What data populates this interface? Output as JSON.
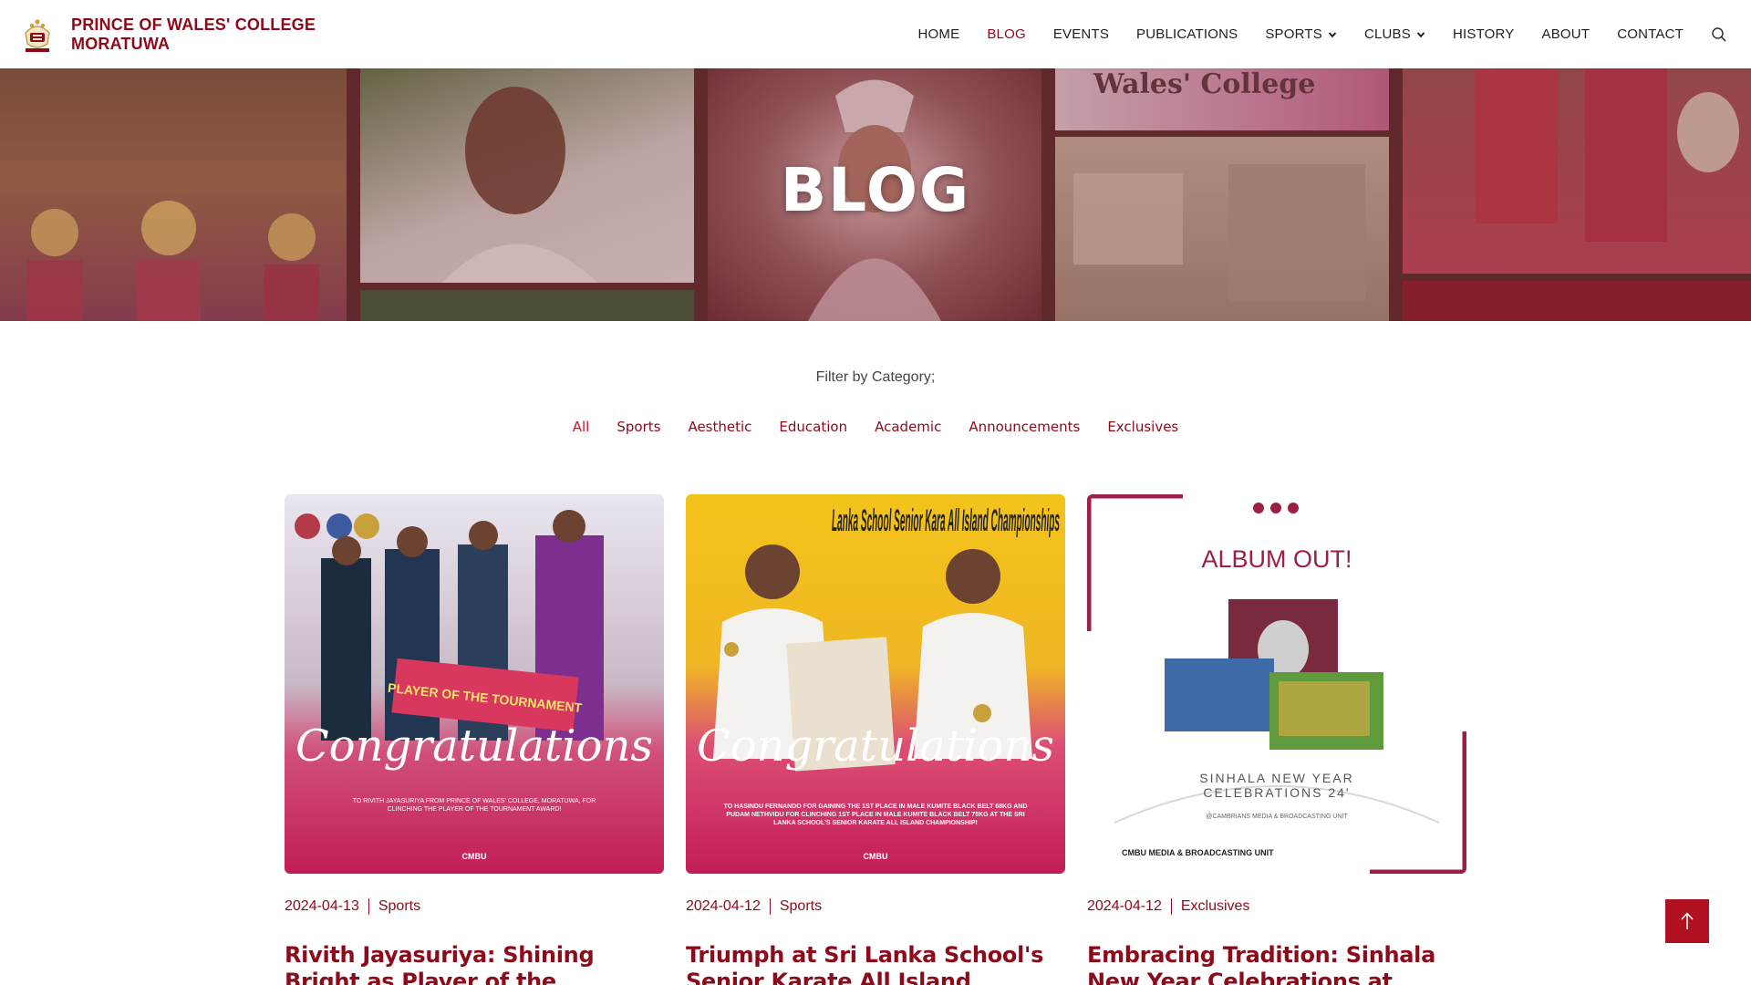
{
  "header": {
    "brand_line1": "PRINCE OF WALES' COLLEGE",
    "brand_line2": "MORATUWA",
    "crest_icon": "college-crest-logo",
    "nav": [
      {
        "label": "HOME",
        "active": false
      },
      {
        "label": "BLOG",
        "active": true
      },
      {
        "label": "EVENTS",
        "active": false
      },
      {
        "label": "PUBLICATIONS",
        "active": false
      },
      {
        "label": "SPORTS",
        "active": false,
        "dropdown": true
      },
      {
        "label": "CLUBS",
        "active": false,
        "dropdown": true
      },
      {
        "label": "HISTORY",
        "active": false
      },
      {
        "label": "ABOUT",
        "active": false
      },
      {
        "label": "CONTACT",
        "active": false
      }
    ],
    "search_icon": "search-icon"
  },
  "hero": {
    "title": "BLOG",
    "tile_texts": [
      "Wales' College"
    ]
  },
  "filter": {
    "label": "Filter by Category;",
    "categories": [
      "All",
      "Sports",
      "Aesthetic",
      "Education",
      "Academic",
      "Announcements",
      "Exclusives"
    ],
    "active": "All"
  },
  "cards": [
    {
      "date": "2024-04-13",
      "category": "Sports",
      "title": "Rivith Jayasuriya: Shining Bright as Player of the Tournament",
      "image_text": "Congratulations",
      "image_banner": "PLAYER OF THE TOURNAMENT",
      "image_caption": "TO RIVITH JAYASURIYA FROM PRINCE OF WALES' COLLEGE, MORATUWA, FOR CLINCHING THE PLAYER OF THE TOURNAMENT AWARD!",
      "image_footer": "CMBU"
    },
    {
      "date": "2024-04-12",
      "category": "Sports",
      "title": "Triumph at Sri Lanka School's Senior Karate All Island Championship",
      "image_text": "Congratulations",
      "image_banner": "Lanka School Senior Kara All Island Championships",
      "image_caption": "TO HASINDU FERNANDO FOR GAINING THE 1ST PLACE IN MALE KUMITE BLACK BELT 68KG AND PUDAM NETHVIDU FOR CLINCHING 1ST PLACE IN MALE KUMITE BLACK BELT 75KG AT THE SRI LANKA SCHOOL'S SENIOR KARATE ALL ISLAND CHAMPIONSHIP!",
      "image_footer": "CMBU"
    },
    {
      "date": "2024-04-12",
      "category": "Exclusives",
      "title": "Embracing Tradition: Sinhala New Year Celebrations at Prince of Wales",
      "image_text": "ALBUM OUT!",
      "image_banner": "SINHALA NEW YEAR CELEBRATIONS 24'",
      "image_caption": "@CAMBRIANS MEDIA & BROADCASTING UNIT",
      "image_footer": "CMBU MEDIA & BROADCASTING UNIT"
    }
  ],
  "back_to_top_icon": "arrow-up-icon",
  "colors": {
    "brand": "#8b0b1b",
    "active": "#d0102a",
    "button": "#b0101f"
  }
}
